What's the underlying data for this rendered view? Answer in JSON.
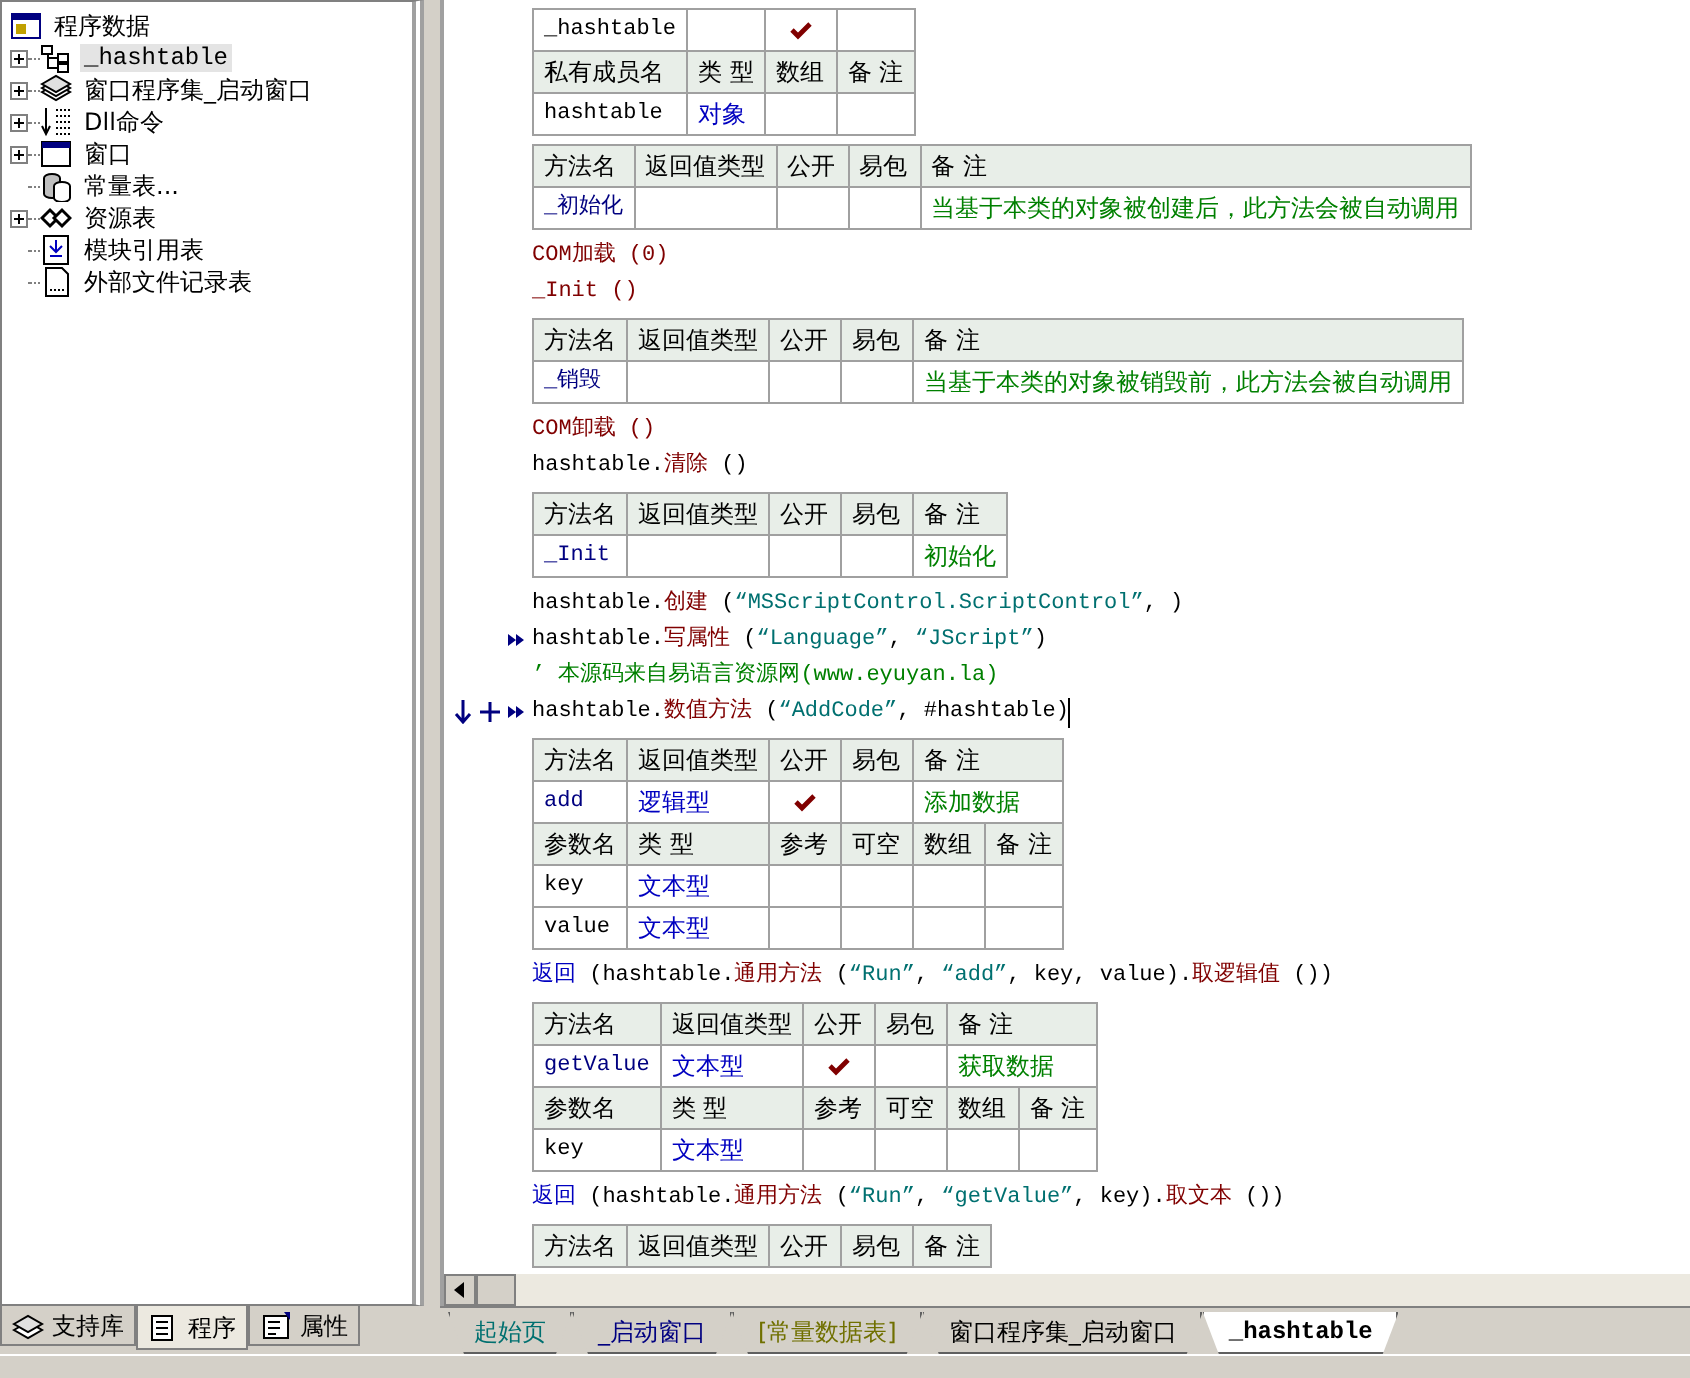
{
  "sidebar": {
    "root": "程序数据",
    "items": [
      {
        "label": "_hashtable",
        "kind": "class",
        "has_children": true,
        "selected": true
      },
      {
        "label": "窗口程序集_启动窗口",
        "kind": "assembly",
        "has_children": true,
        "selected": false
      },
      {
        "label": "Dll命令",
        "kind": "dll",
        "has_children": true,
        "selected": false
      },
      {
        "label": "窗口",
        "kind": "window",
        "has_children": true,
        "selected": false
      },
      {
        "label": "常量表...",
        "kind": "constants",
        "has_children": false,
        "selected": false
      },
      {
        "label": "资源表",
        "kind": "resources",
        "has_children": true,
        "selected": false
      },
      {
        "label": "模块引用表",
        "kind": "module",
        "has_children": false,
        "selected": false
      },
      {
        "label": "外部文件记录表",
        "kind": "file",
        "has_children": false,
        "selected": false
      }
    ],
    "tabs": [
      {
        "label": "支持库",
        "kind": "library",
        "selected": false
      },
      {
        "label": "程序",
        "kind": "program",
        "selected": true
      },
      {
        "label": "属性",
        "kind": "properties",
        "selected": false
      }
    ]
  },
  "editor": {
    "blocks": [
      {
        "kind": "table",
        "rows": [
          {
            "cells": [
              {
                "kind": "name",
                "text": "_hashtable"
              },
              {
                "kind": "blank"
              },
              {
                "kind": "check",
                "checked": true
              },
              {
                "kind": "blank"
              }
            ]
          },
          {
            "cells": [
              {
                "kind": "header",
                "text": "私有成员名"
              },
              {
                "kind": "header",
                "text": "类 型"
              },
              {
                "kind": "header",
                "text": "数组"
              },
              {
                "kind": "header",
                "text": "备 注"
              }
            ]
          },
          {
            "cells": [
              {
                "kind": "name",
                "text": "hashtable"
              },
              {
                "kind": "type",
                "text": "对象"
              },
              {
                "kind": "blank"
              },
              {
                "kind": "blank"
              }
            ]
          }
        ]
      },
      {
        "kind": "table",
        "rows": [
          {
            "cells": [
              {
                "kind": "header",
                "text": "方法名"
              },
              {
                "kind": "header",
                "text": "返回值类型"
              },
              {
                "kind": "header",
                "text": "公开"
              },
              {
                "kind": "header",
                "text": "易包"
              },
              {
                "kind": "header",
                "text": "备 注"
              }
            ]
          },
          {
            "cells": [
              {
                "kind": "method",
                "text": "_初始化"
              },
              {
                "kind": "blank"
              },
              {
                "kind": "check",
                "checked": false
              },
              {
                "kind": "check",
                "checked": false
              },
              {
                "kind": "note",
                "text": "当基于本类的对象被创建后，此方法会被自动调用"
              }
            ]
          }
        ]
      },
      {
        "kind": "line",
        "segments": [
          {
            "kind": "command",
            "text": "COM加载 (0)"
          }
        ]
      },
      {
        "kind": "line",
        "segments": [
          {
            "kind": "command",
            "text": "_Init ()"
          }
        ]
      },
      {
        "kind": "table",
        "rows": [
          {
            "cells": [
              {
                "kind": "header",
                "text": "方法名"
              },
              {
                "kind": "header",
                "text": "返回值类型"
              },
              {
                "kind": "header",
                "text": "公开"
              },
              {
                "kind": "header",
                "text": "易包"
              },
              {
                "kind": "header",
                "text": "备 注"
              }
            ]
          },
          {
            "cells": [
              {
                "kind": "method",
                "text": "_销毁"
              },
              {
                "kind": "blank"
              },
              {
                "kind": "check",
                "checked": false
              },
              {
                "kind": "check",
                "checked": false
              },
              {
                "kind": "note",
                "text": "当基于本类的对象被销毁前，此方法会被自动调用"
              }
            ]
          }
        ]
      },
      {
        "kind": "line",
        "segments": [
          {
            "kind": "command",
            "text": "COM卸载 ()"
          }
        ]
      },
      {
        "kind": "line",
        "segments": [
          {
            "kind": "plain",
            "text": "hashtable."
          },
          {
            "kind": "command",
            "text": "清除"
          },
          {
            "kind": "plain",
            "text": " ()"
          }
        ]
      },
      {
        "kind": "table",
        "rows": [
          {
            "cells": [
              {
                "kind": "header",
                "text": "方法名"
              },
              {
                "kind": "header",
                "text": "返回值类型"
              },
              {
                "kind": "header",
                "text": "公开"
              },
              {
                "kind": "header",
                "text": "易包"
              },
              {
                "kind": "header",
                "text": "备 注"
              }
            ]
          },
          {
            "cells": [
              {
                "kind": "method",
                "text": "_Init"
              },
              {
                "kind": "blank"
              },
              {
                "kind": "check",
                "checked": false
              },
              {
                "kind": "check",
                "checked": false
              },
              {
                "kind": "note",
                "text": "初始化"
              }
            ]
          }
        ]
      },
      {
        "kind": "line",
        "segments": [
          {
            "kind": "plain",
            "text": "hashtable."
          },
          {
            "kind": "command",
            "text": "创建"
          },
          {
            "kind": "plain",
            "text": " ("
          },
          {
            "kind": "string",
            "text": "“MSScriptControl.ScriptControl”"
          },
          {
            "kind": "plain",
            "text": ", )"
          }
        ]
      },
      {
        "kind": "line",
        "marker": true,
        "segments": [
          {
            "kind": "plain",
            "text": "hashtable."
          },
          {
            "kind": "command",
            "text": "写属性"
          },
          {
            "kind": "plain",
            "text": " ("
          },
          {
            "kind": "string",
            "text": "“Language”"
          },
          {
            "kind": "plain",
            "text": ", "
          },
          {
            "kind": "string",
            "text": "“JScript”"
          },
          {
            "kind": "plain",
            "text": ")"
          }
        ]
      },
      {
        "kind": "line",
        "segments": [
          {
            "kind": "comment",
            "text": "’ 本源码来自易语言资源网(www.eyuyan.la)"
          }
        ]
      },
      {
        "kind": "line",
        "marker": true,
        "current": true,
        "caret": true,
        "segments": [
          {
            "kind": "plain",
            "text": "hashtable."
          },
          {
            "kind": "command",
            "text": "数值方法"
          },
          {
            "kind": "plain",
            "text": " ("
          },
          {
            "kind": "string",
            "text": "“AddCode”"
          },
          {
            "kind": "plain",
            "text": ", #hashtable)"
          }
        ]
      },
      {
        "kind": "table",
        "rows": [
          {
            "cells": [
              {
                "kind": "header",
                "text": "方法名"
              },
              {
                "kind": "header",
                "text": "返回值类型"
              },
              {
                "kind": "header",
                "text": "公开"
              },
              {
                "kind": "header",
                "text": "易包"
              },
              {
                "kind": "header",
                "text": "备 注",
                "colspan": 2
              }
            ]
          },
          {
            "cells": [
              {
                "kind": "method",
                "text": "add"
              },
              {
                "kind": "type",
                "text": "逻辑型"
              },
              {
                "kind": "check",
                "checked": true
              },
              {
                "kind": "check",
                "checked": false
              },
              {
                "kind": "note",
                "text": "添加数据",
                "colspan": 2
              }
            ]
          },
          {
            "cells": [
              {
                "kind": "header",
                "text": "参数名"
              },
              {
                "kind": "header",
                "text": "类 型"
              },
              {
                "kind": "header",
                "text": "参考"
              },
              {
                "kind": "header",
                "text": "可空"
              },
              {
                "kind": "header",
                "text": "数组"
              },
              {
                "kind": "header",
                "text": "备 注"
              }
            ]
          },
          {
            "cells": [
              {
                "kind": "name",
                "text": "key"
              },
              {
                "kind": "type",
                "text": "文本型"
              },
              {
                "kind": "check",
                "checked": false
              },
              {
                "kind": "check",
                "checked": false
              },
              {
                "kind": "check",
                "checked": false
              },
              {
                "kind": "blank"
              }
            ]
          },
          {
            "cells": [
              {
                "kind": "name",
                "text": "value"
              },
              {
                "kind": "type",
                "text": "文本型"
              },
              {
                "kind": "check",
                "checked": false
              },
              {
                "kind": "check",
                "checked": false
              },
              {
                "kind": "check",
                "checked": false
              },
              {
                "kind": "blank"
              }
            ]
          }
        ]
      },
      {
        "kind": "line",
        "segments": [
          {
            "kind": "keyword",
            "text": "返回"
          },
          {
            "kind": "plain",
            "text": " (hashtable."
          },
          {
            "kind": "command",
            "text": "通用方法"
          },
          {
            "kind": "plain",
            "text": " ("
          },
          {
            "kind": "string",
            "text": "“Run”"
          },
          {
            "kind": "plain",
            "text": ", "
          },
          {
            "kind": "string",
            "text": "“add”"
          },
          {
            "kind": "plain",
            "text": ", key, value)."
          },
          {
            "kind": "command",
            "text": "取逻辑值"
          },
          {
            "kind": "plain",
            "text": " ())"
          }
        ]
      },
      {
        "kind": "table",
        "rows": [
          {
            "cells": [
              {
                "kind": "header",
                "text": "方法名"
              },
              {
                "kind": "header",
                "text": "返回值类型"
              },
              {
                "kind": "header",
                "text": "公开"
              },
              {
                "kind": "header",
                "text": "易包"
              },
              {
                "kind": "header",
                "text": "备 注",
                "colspan": 2
              }
            ]
          },
          {
            "cells": [
              {
                "kind": "method",
                "text": "getValue"
              },
              {
                "kind": "type",
                "text": "文本型"
              },
              {
                "kind": "check",
                "checked": true
              },
              {
                "kind": "check",
                "checked": false
              },
              {
                "kind": "note",
                "text": "获取数据",
                "colspan": 2
              }
            ]
          },
          {
            "cells": [
              {
                "kind": "header",
                "text": "参数名"
              },
              {
                "kind": "header",
                "text": "类 型"
              },
              {
                "kind": "header",
                "text": "参考"
              },
              {
                "kind": "header",
                "text": "可空"
              },
              {
                "kind": "header",
                "text": "数组"
              },
              {
                "kind": "header",
                "text": "备 注"
              }
            ]
          },
          {
            "cells": [
              {
                "kind": "name",
                "text": "key"
              },
              {
                "kind": "type",
                "text": "文本型"
              },
              {
                "kind": "check",
                "checked": false
              },
              {
                "kind": "check",
                "checked": false
              },
              {
                "kind": "check",
                "checked": false
              },
              {
                "kind": "blank"
              }
            ]
          }
        ]
      },
      {
        "kind": "line",
        "segments": [
          {
            "kind": "keyword",
            "text": "返回"
          },
          {
            "kind": "plain",
            "text": " (hashtable."
          },
          {
            "kind": "command",
            "text": "通用方法"
          },
          {
            "kind": "plain",
            "text": " ("
          },
          {
            "kind": "string",
            "text": "“Run”"
          },
          {
            "kind": "plain",
            "text": ", "
          },
          {
            "kind": "string",
            "text": "“getValue”"
          },
          {
            "kind": "plain",
            "text": ", key)."
          },
          {
            "kind": "command",
            "text": "取文本"
          },
          {
            "kind": "plain",
            "text": " ())"
          }
        ]
      },
      {
        "kind": "table",
        "rows": [
          {
            "cells": [
              {
                "kind": "header",
                "text": "方法名"
              },
              {
                "kind": "header",
                "text": "返回值类型"
              },
              {
                "kind": "header",
                "text": "公开"
              },
              {
                "kind": "header",
                "text": "易包"
              },
              {
                "kind": "header",
                "text": "备 注"
              }
            ]
          }
        ]
      }
    ],
    "tabs": [
      {
        "label": "起始页",
        "color": "#007070",
        "selected": false
      },
      {
        "label": "_启动窗口",
        "color": "#000080",
        "selected": false
      },
      {
        "label": "[常量数据表]",
        "color": "#707000",
        "selected": false
      },
      {
        "label": "窗口程序集_启动窗口",
        "color": "#000000",
        "selected": false
      },
      {
        "label": "_hashtable",
        "color": "#000000",
        "selected": true
      }
    ]
  }
}
